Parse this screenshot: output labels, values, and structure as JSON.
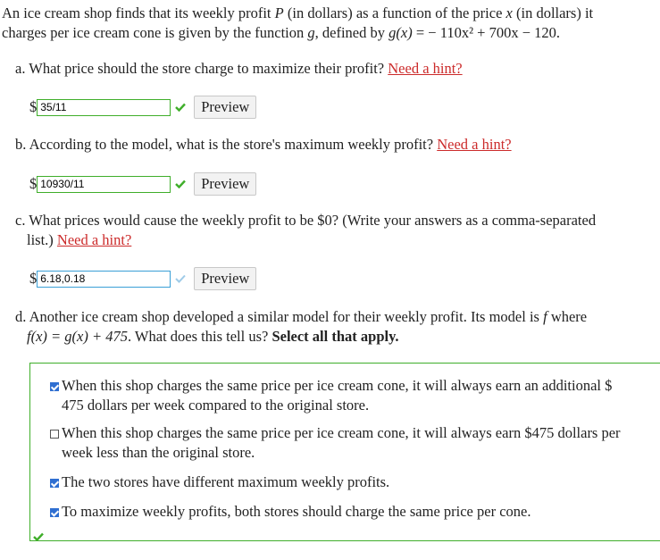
{
  "intro": {
    "line1_a": "An ice cream shop finds that its weekly profit ",
    "P": "P",
    "line1_b": " (in dollars) as a function of the price ",
    "x": "x",
    "line1_c": " (in dollars) it",
    "line2_a": "charges per ice cream cone is given by the function ",
    "g": "g",
    "line2_b": ", defined by ",
    "formula_lhs": "g(x)",
    "formula_rhs": " = − 110x² + 700x − 120."
  },
  "parts": {
    "a": {
      "question": "a. What price should the store charge to maximize their profit? ",
      "hint": "Need a hint?",
      "dollar": "$",
      "value": "35/11",
      "preview": "Preview"
    },
    "b": {
      "question": "b. According to the model, what is the store's maximum weekly profit? ",
      "hint": "Need a hint?",
      "dollar": "$",
      "value": "10930/11",
      "preview": "Preview"
    },
    "c": {
      "question_line1": "c. What prices would cause the weekly profit to be $0? (Write your answers as a comma-separated",
      "question_line2": "list.) ",
      "hint": "Need a hint?",
      "dollar": "$",
      "value": "6.18,0.18",
      "preview": "Preview"
    },
    "d": {
      "line1_a": "d. Another ice cream shop developed a similar model for their weekly profit. Its model is ",
      "f": "f",
      "line1_b": " where",
      "formula": "f(x) = g(x) + 475",
      "line2_b": ". What does this tell us? ",
      "bold": "Select all that apply."
    }
  },
  "choices": [
    {
      "line1": "When this shop charges the same price per ice cream cone, it will always earn an additional $",
      "line2": "475 dollars per week compared to the original store.",
      "checked": true
    },
    {
      "line1": "When this shop charges the same price per ice cream cone, it will always earn $475 dollars per",
      "line2": "week less than the original store.",
      "checked": false
    },
    {
      "line1": "The two stores have different maximum weekly profits.",
      "line2": "",
      "checked": true
    },
    {
      "line1": "To maximize weekly profits, both stores should charge the same price per cone.",
      "line2": "",
      "checked": true
    }
  ],
  "colors": {
    "correct": "#3fae2a",
    "pending": "#3a9fd6",
    "hint": "#cc2b2b",
    "checkbox": "#2f6fd1"
  },
  "icons": {
    "correct": "checkmark-icon",
    "pending": "checkmark-outline-icon"
  }
}
